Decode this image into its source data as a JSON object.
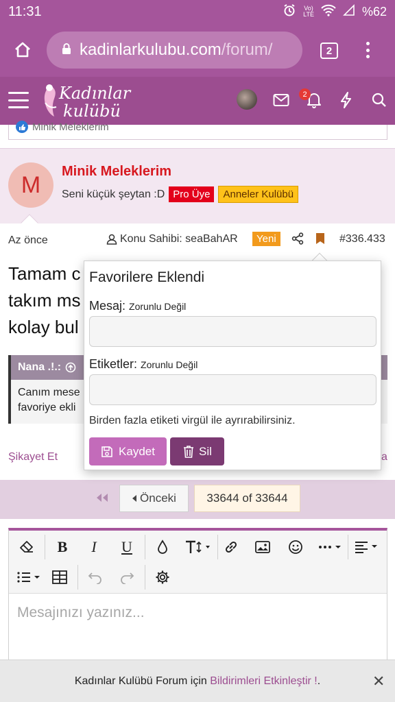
{
  "status_bar": {
    "time": "11:31",
    "lte_top": "Vo)",
    "lte_bottom": "LTE",
    "battery": "%62"
  },
  "browser": {
    "url_domain": "kadinlarkulubu.com",
    "url_path": "/forum/",
    "tab_count": "2"
  },
  "site_header": {
    "logo_line1": "Kadınlar",
    "logo_line2": "kulübü",
    "notification_count": "2"
  },
  "previous_post": {
    "reaction_user": "Minik Meleklerim"
  },
  "post": {
    "avatar_letter": "M",
    "username": "Minik Meleklerim",
    "user_title": "Seni küçük şeytan :D",
    "badge_1": "Pro Üye",
    "badge_2": "Anneler Kulübü",
    "time": "Az önce",
    "thread_owner": "Konu Sahibi: seaBahAR",
    "new_label": "Yeni",
    "post_number": "#336.433",
    "text_line1": "Tamam c",
    "text_line2": "takım ms",
    "text_line3": "kolay bul",
    "quote_author": "Nana .!.:",
    "quote_line1": "Canım mese",
    "quote_line2": "favoriye ekli",
    "report_label": "Şikayet Et",
    "right_action_partial": "a"
  },
  "pagination": {
    "prev_label": "Önceki",
    "page_indicator": "33644 of 33644"
  },
  "editor": {
    "placeholder": "Mesajınızı yazınız..."
  },
  "bookmark_popup": {
    "title": "Favorilere Eklendi",
    "message_label": "Mesaj:",
    "message_optional": "Zorunlu Değil",
    "message_value": "",
    "tags_label": "Etiketler:",
    "tags_optional": "Zorunlu Değil",
    "tags_value": "",
    "hint": "Birden fazla etiketi virgül ile ayrırabilirsiniz.",
    "save_label": "Kaydet",
    "delete_label": "Sil"
  },
  "notice": {
    "text_before": "Kadınlar Kulübü Forum için ",
    "link_text": "Bildirimleri Etkinleştir !",
    "text_after": ".",
    "close_symbol": "✕"
  },
  "colors": {
    "brand": "#a5559b",
    "header": "#9c4d90",
    "accent_red": "#d7181f",
    "badge_yellow": "#ffc21a",
    "new_orange": "#f29a1c"
  }
}
